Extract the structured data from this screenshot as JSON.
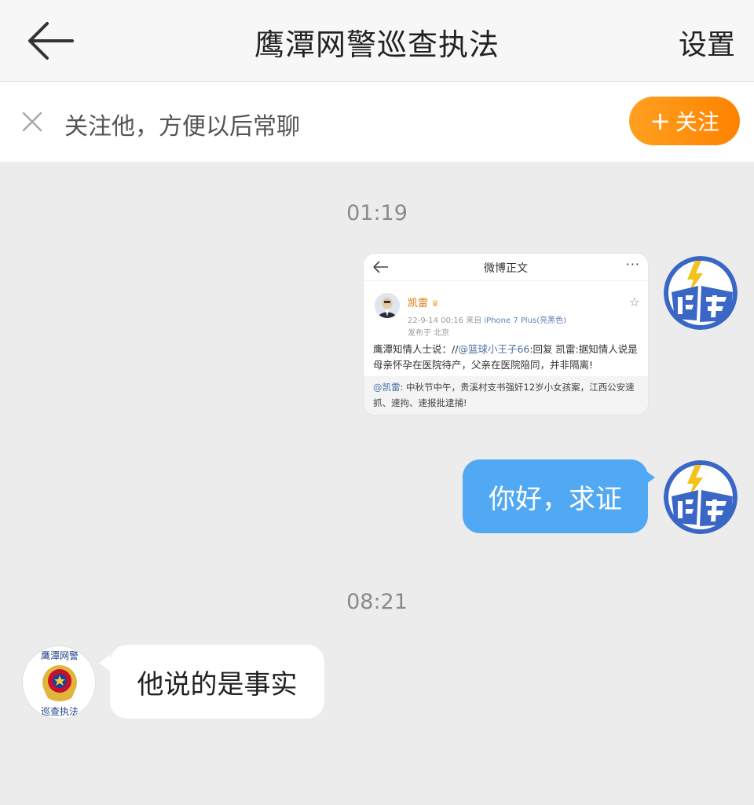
{
  "header": {
    "title": "鹰潭网警巡查执法",
    "settings_label": "设置"
  },
  "follow_bar": {
    "text": "关注他，方便以后常聊",
    "button_label": "关注",
    "accent_color": "#ff8c10"
  },
  "messages": [
    {
      "time": "01:19",
      "sender": "self",
      "type": "image",
      "screenshot": {
        "title": "微博正文",
        "more": "···",
        "name": "凯雷",
        "date": "22-9-14 00:16",
        "date_source_prefix": "来自",
        "device": "iPhone 7 Plus(亮黑色)",
        "location": "发布于 北京",
        "body_prefix": "鹰潭知情人士说：//",
        "body_mention": "@篮球小王子66",
        "body_rest": ":回复 凯雷:据知情人说是母亲怀孕在医院待产，父亲在医院陪同，并非隔离!",
        "quote_mention": "@凯雷",
        "quote_text": ": 中秋节中午，贵溪村支书强奸12岁小女孩案，江西公安速抓、速拘、速报批逮捕!"
      }
    },
    {
      "sender": "self",
      "type": "text",
      "text": "你好，求证"
    },
    {
      "time": "08:21",
      "sender": "other",
      "type": "text",
      "text": "他说的是事实"
    }
  ],
  "avatars": {
    "police_top_text": "鹰潭网警",
    "police_bottom_text": "巡查执法"
  },
  "colors": {
    "bubble_out": "#51a8f3",
    "bubble_in": "#ffffff",
    "background": "#ececec"
  }
}
